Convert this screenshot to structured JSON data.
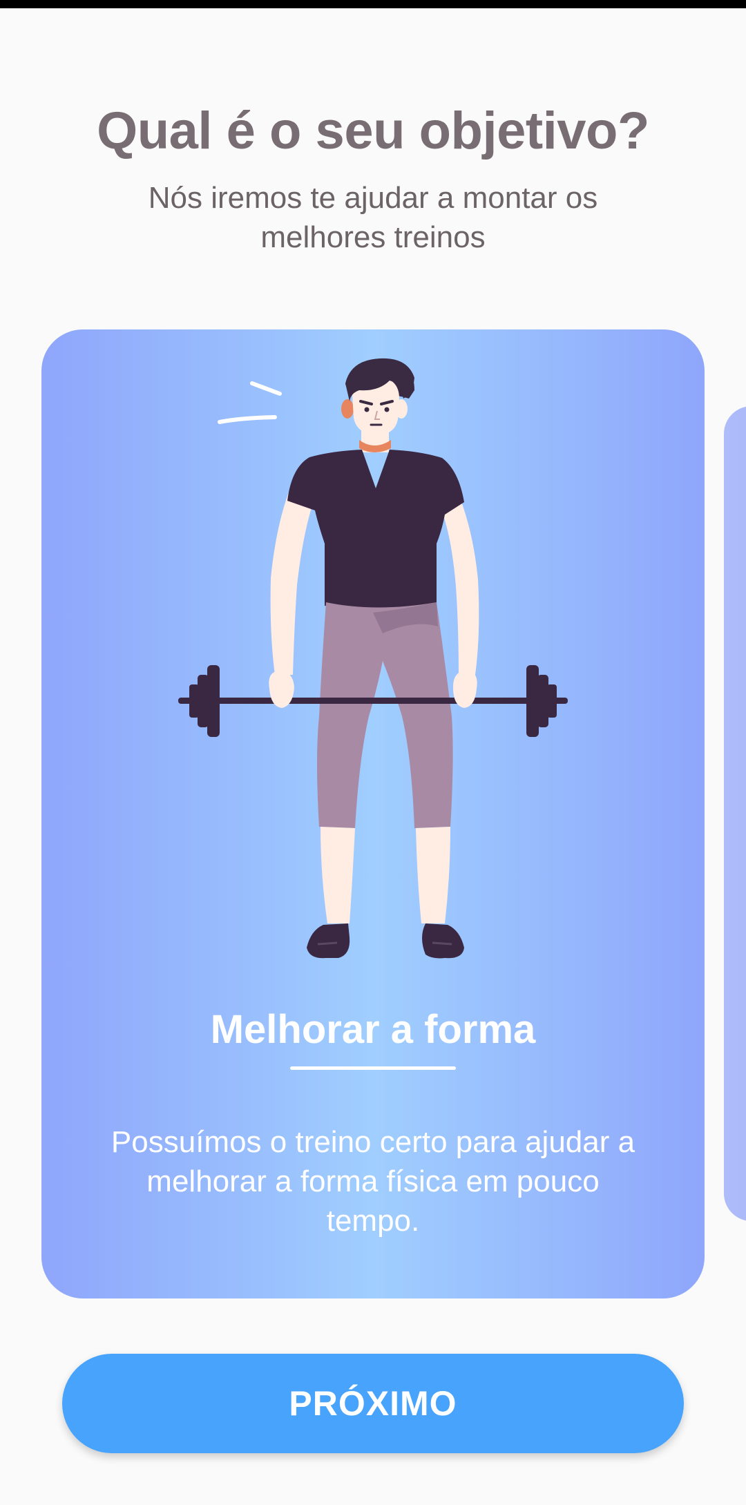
{
  "header": {
    "title": "Qual é o seu objetivo?",
    "subtitle": "Nós iremos te ajudar a montar os melhores treinos"
  },
  "goal_card": {
    "title": "Melhorar a forma",
    "description": "Possuímos o treino certo para ajudar a melhorar a forma física em pouco tempo.",
    "illustration": "man-lifting-barbell"
  },
  "next_card": {
    "state": "partially-visible"
  },
  "actions": {
    "next_label": "PRÓXIMO"
  },
  "colors": {
    "background": "#fafafa",
    "title_text": "#786d72",
    "subtitle_text": "#6b6366",
    "card_gradient_edge": "#8fa6fb",
    "card_gradient_center": "#a0cefe",
    "button": "#47a3fb",
    "button_text": "#ffffff"
  }
}
